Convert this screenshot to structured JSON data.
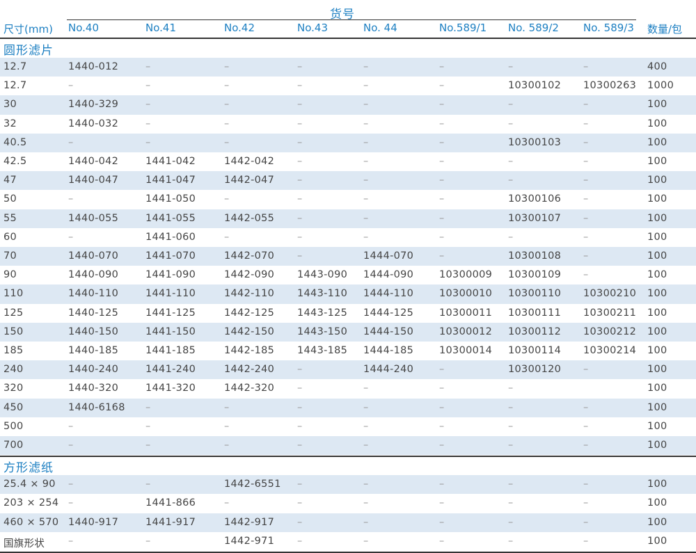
{
  "group_header": "货号",
  "columns": [
    "尺寸(mm)",
    "No.40",
    "No.41",
    "No.42",
    "No.43",
    "No. 44",
    "No.589/1",
    "No. 589/2",
    "No. 589/3",
    "数量/包"
  ],
  "sections": [
    {
      "title": "圆形滤片",
      "rows": [
        [
          "12.7",
          "1440-012",
          "–",
          "–",
          "–",
          "–",
          "–",
          "–",
          "–",
          "400"
        ],
        [
          "12.7",
          "–",
          "–",
          "–",
          "–",
          "–",
          "–",
          "10300102",
          "10300263",
          "1000"
        ],
        [
          "30",
          "1440-329",
          "–",
          "–",
          "–",
          "–",
          "–",
          "–",
          "–",
          "100"
        ],
        [
          "32",
          "1440-032",
          "–",
          "–",
          "–",
          "–",
          "–",
          "–",
          "–",
          "100"
        ],
        [
          "40.5",
          "–",
          "–",
          "–",
          "–",
          "–",
          "–",
          "10300103",
          "–",
          "100"
        ],
        [
          "42.5",
          "1440-042",
          "1441-042",
          "1442-042",
          "–",
          "–",
          "–",
          "–",
          "–",
          "100"
        ],
        [
          "47",
          "1440-047",
          "1441-047",
          "1442-047",
          "–",
          "–",
          "–",
          "–",
          "–",
          "100"
        ],
        [
          "50",
          "–",
          "1441-050",
          "–",
          "–",
          "–",
          "–",
          "10300106",
          "–",
          "100"
        ],
        [
          "55",
          "1440-055",
          "1441-055",
          "1442-055",
          "–",
          "–",
          "–",
          "10300107",
          "–",
          "100"
        ],
        [
          "60",
          "–",
          "1441-060",
          "–",
          "–",
          "–",
          "–",
          "–",
          "–",
          "100"
        ],
        [
          "70",
          "1440-070",
          "1441-070",
          "1442-070",
          "–",
          "1444-070",
          "–",
          "10300108",
          "–",
          "100"
        ],
        [
          "90",
          "1440-090",
          "1441-090",
          "1442-090",
          "1443-090",
          "1444-090",
          "10300009",
          "10300109",
          "–",
          "100"
        ],
        [
          "110",
          "1440-110",
          "1441-110",
          "1442-110",
          "1443-110",
          "1444-110",
          "10300010",
          "10300110",
          "10300210",
          "100"
        ],
        [
          "125",
          "1440-125",
          "1441-125",
          "1442-125",
          "1443-125",
          "1444-125",
          "10300011",
          "10300111",
          "10300211",
          "100"
        ],
        [
          "150",
          "1440-150",
          "1441-150",
          "1442-150",
          "1443-150",
          "1444-150",
          "10300012",
          "10300112",
          "10300212",
          "100"
        ],
        [
          "185",
          "1440-185",
          "1441-185",
          "1442-185",
          "1443-185",
          "1444-185",
          "10300014",
          "10300114",
          "10300214",
          "100"
        ],
        [
          "240",
          "1440-240",
          "1441-240",
          "1442-240",
          "–",
          "1444-240",
          "–",
          "10300120",
          "–",
          "100"
        ],
        [
          "320",
          "1440-320",
          "1441-320",
          "1442-320",
          "–",
          "–",
          "–",
          "–",
          "",
          "100"
        ],
        [
          "450",
          "1440-6168",
          "–",
          "–",
          "–",
          "–",
          "–",
          "–",
          "–",
          "100"
        ],
        [
          "500",
          "–",
          "–",
          "–",
          "–",
          "–",
          "–",
          "–",
          "–",
          "100"
        ],
        [
          "700",
          "–",
          "–",
          "–",
          "–",
          "–",
          "–",
          "–",
          "–",
          "100"
        ]
      ]
    },
    {
      "title": "方形滤纸",
      "rows": [
        [
          "25.4 × 90",
          "–",
          "–",
          "1442-6551",
          "–",
          "–",
          "–",
          "–",
          "–",
          "100"
        ],
        [
          "203 × 254",
          "–",
          "1441-866",
          "–",
          "–",
          "–",
          "–",
          "–",
          "–",
          "100"
        ],
        [
          "460 × 570",
          "1440-917",
          "1441-917",
          "1442-917",
          "–",
          "–",
          "–",
          "–",
          "–",
          "100"
        ],
        [
          "国旗形状",
          "–",
          "–",
          "1442-971",
          "–",
          "–",
          "–",
          "–",
          "–",
          "100"
        ]
      ]
    }
  ]
}
